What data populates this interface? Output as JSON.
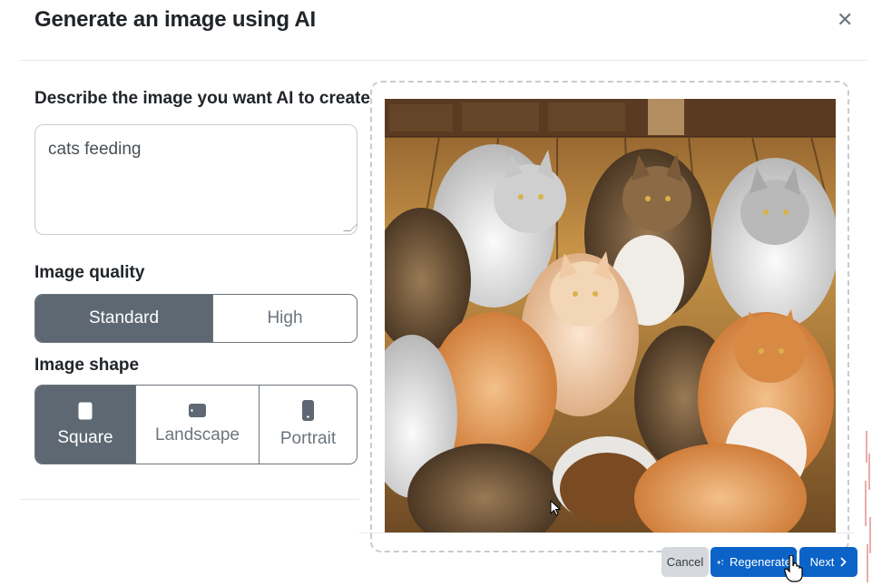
{
  "dialog": {
    "title": "Generate an image using AI",
    "close_icon": "close-icon"
  },
  "prompt": {
    "label": "Describe the image you want AI to create",
    "value": "cats feeding"
  },
  "quality": {
    "label": "Image quality",
    "options": [
      "Standard",
      "High"
    ],
    "selected": "Standard"
  },
  "shape": {
    "label": "Image shape",
    "options": [
      {
        "label": "Square",
        "icon": "square-shape-icon"
      },
      {
        "label": "Landscape",
        "icon": "landscape-shape-icon"
      },
      {
        "label": "Portrait",
        "icon": "portrait-shape-icon"
      }
    ],
    "selected": "Square"
  },
  "preview": {
    "image": "generated-image"
  },
  "footer": {
    "cancel_label": "Cancel",
    "regenerate_label": "Regenerate",
    "regenerate_icon": "sparkle-icon",
    "next_label": "Next",
    "next_icon": "chevron-right-icon"
  },
  "colors": {
    "primary": "#0b63c8",
    "segment_active": "#5d6872",
    "cancel_bg": "#d5d9dd"
  }
}
